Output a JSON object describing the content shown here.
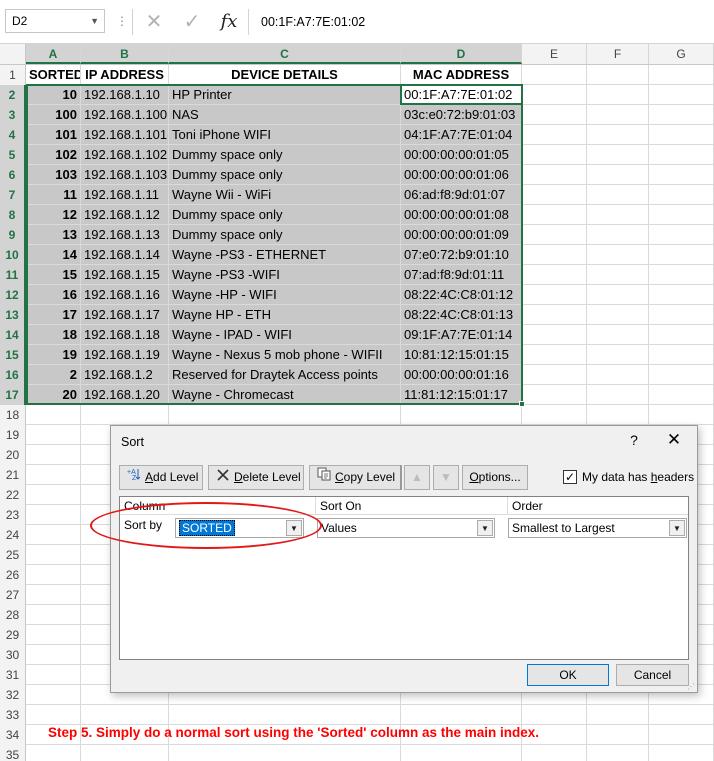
{
  "formula_bar": {
    "name_box": "D2",
    "formula": "00:1F:A7:7E:01:02",
    "fx_label": "fx",
    "cancel_glyph": "✕",
    "enter_glyph": "✓",
    "dots": "⋮",
    "dropdown_glyph": "▼"
  },
  "columns": [
    "A",
    "B",
    "C",
    "D",
    "E",
    "F",
    "G"
  ],
  "headers": {
    "sorted": "SORTED",
    "ip": "IP ADDRESS",
    "device": "DEVICE DETAILS",
    "mac": "MAC ADDRESS"
  },
  "rows": [
    {
      "sorted": "10",
      "ip": "192.168.1.10",
      "device": "HP  Printer",
      "mac": "00:1F:A7:7E:01:02"
    },
    {
      "sorted": "100",
      "ip": "192.168.1.100",
      "device": "NAS",
      "mac": "03c:e0:72:b9:01:03"
    },
    {
      "sorted": "101",
      "ip": "192.168.1.101",
      "device": "Toni iPhone WIFI",
      "mac": "04:1F:A7:7E:01:04"
    },
    {
      "sorted": "102",
      "ip": "192.168.1.102",
      "device": "Dummy space only",
      "mac": "00:00:00:00:01:05"
    },
    {
      "sorted": "103",
      "ip": "192.168.1.103",
      "device": "Dummy space only",
      "mac": "00:00:00:00:01:06"
    },
    {
      "sorted": "11",
      "ip": "192.168.1.11",
      "device": "Wayne Wii - WiFi",
      "mac": "06:ad:f8:9d:01:07"
    },
    {
      "sorted": "12",
      "ip": "192.168.1.12",
      "device": "Dummy space only",
      "mac": "00:00:00:00:01:08"
    },
    {
      "sorted": "13",
      "ip": "192.168.1.13",
      "device": "Dummy space only",
      "mac": "00:00:00:00:01:09"
    },
    {
      "sorted": "14",
      "ip": "192.168.1.14",
      "device": "Wayne -PS3 - ETHERNET",
      "mac": "07:e0:72:b9:01:10"
    },
    {
      "sorted": "15",
      "ip": "192.168.1.15",
      "device": "Wayne -PS3 -WIFI",
      "mac": "07:ad:f8:9d:01:11"
    },
    {
      "sorted": "16",
      "ip": "192.168.1.16",
      "device": "Wayne -HP - WIFI",
      "mac": "08:22:4C:C8:01:12"
    },
    {
      "sorted": "17",
      "ip": "192.168.1.17",
      "device": "Wayne  HP - ETH",
      "mac": "08:22:4C:C8:01:13"
    },
    {
      "sorted": "18",
      "ip": "192.168.1.18",
      "device": "Wayne - IPAD - WIFI",
      "mac": "09:1F:A7:7E:01:14"
    },
    {
      "sorted": "19",
      "ip": "192.168.1.19",
      "device": "Wayne - Nexus 5 mob phone - WIFII",
      "mac": "10:81:12:15:01:15"
    },
    {
      "sorted": "2",
      "ip": "192.168.1.2",
      "device": "Reserved for Draytek Access points",
      "mac": "00:00:00:00:01:16"
    },
    {
      "sorted": "20",
      "ip": "192.168.1.20",
      "device": "Wayne - Chromecast",
      "mac": "11:81:12:15:01:17"
    }
  ],
  "row_numbers": [
    "1",
    "2",
    "3",
    "4",
    "5",
    "6",
    "7",
    "8",
    "9",
    "10",
    "11",
    "12",
    "13",
    "14",
    "15",
    "16",
    "17",
    "18",
    "19",
    "20",
    "21",
    "22",
    "23",
    "24",
    "25",
    "26",
    "27",
    "28",
    "29",
    "30",
    "31",
    "32",
    "33",
    "34",
    "35"
  ],
  "step_text": "Step 5.  Simply do a normal sort using the 'Sorted' column as the main index.",
  "sort_dialog": {
    "title": "Sort",
    "help": "?",
    "close": "✕",
    "add_level": "Add Level",
    "delete_level": "Delete Level",
    "copy_level": "Copy Level",
    "move_up": "▲",
    "move_down": "▼",
    "options": "Options...",
    "my_data_has_headers": "My data has headers",
    "headers_checked": true,
    "check_glyph": "✓",
    "col_header": "Column",
    "sort_on_header": "Sort On",
    "order_header": "Order",
    "sort_by_label": "Sort by",
    "column_value": "SORTED",
    "sort_on_value": "Values",
    "order_value": "Smallest to Largest",
    "ok": "OK",
    "cancel": "Cancel",
    "combo_arrow": "▼",
    "resize_grip": "⋰"
  },
  "colors": {
    "selection_green": "#217346",
    "cell_shade": "#c8c8c8",
    "annotation_red": "#ff0000"
  }
}
